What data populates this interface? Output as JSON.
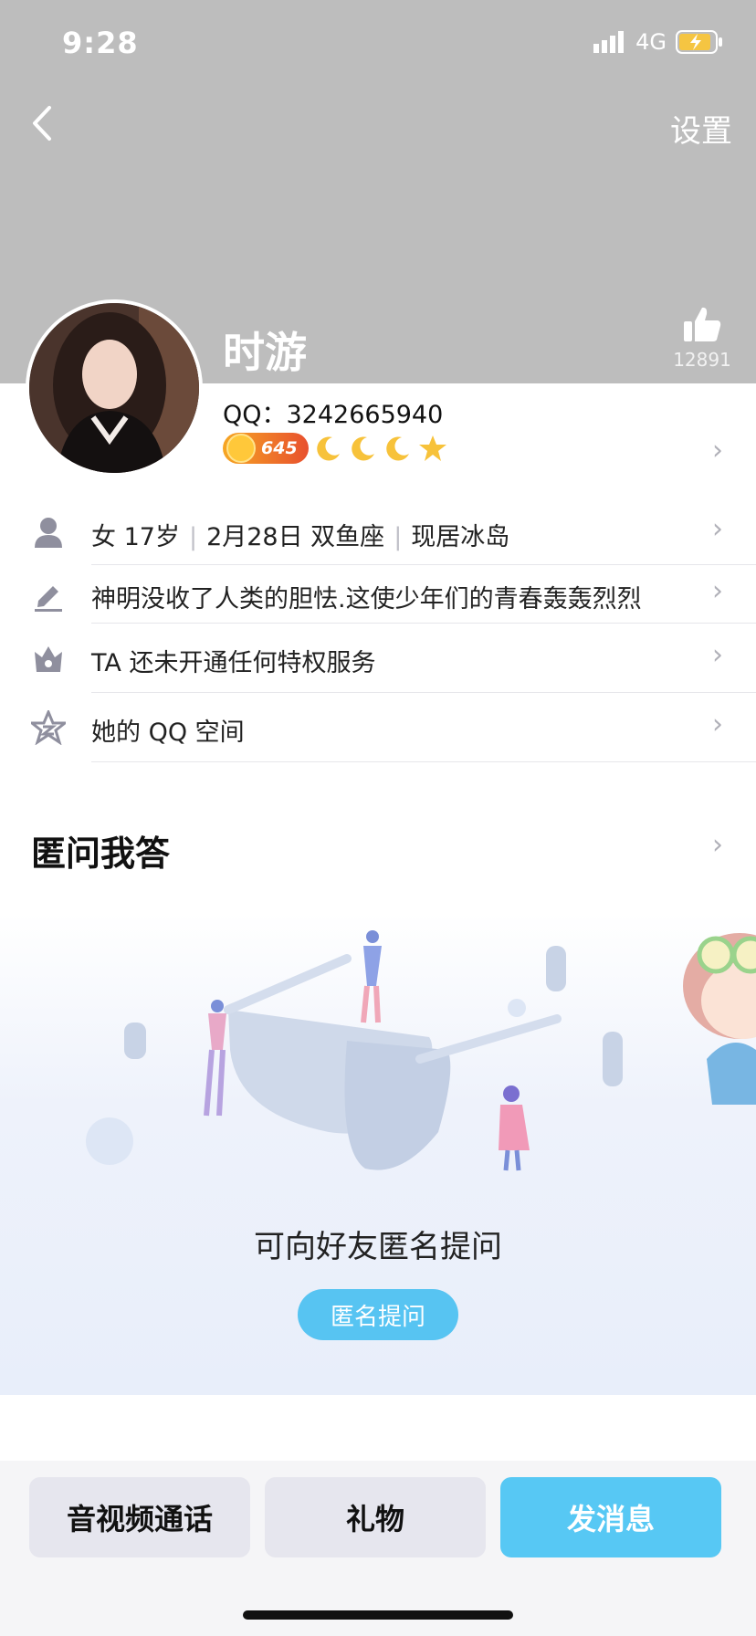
{
  "status_bar": {
    "time": "9:28",
    "network": "4G"
  },
  "nav": {
    "settings_label": "设置"
  },
  "profile": {
    "nickname": "时游",
    "likes": "12891",
    "qq_line": "QQ：3242665940",
    "coin_level": "645"
  },
  "info": {
    "gender": "女",
    "age": "17岁",
    "birthday": "2月28日 双鱼座",
    "location": "现居冰岛",
    "signature": "神明没收了人类的胆怯.这使少年们的青春轰轰烈烈",
    "privilege": "TA 还未开通任何特权服务",
    "qzone": "她的 QQ 空间"
  },
  "anonymous": {
    "title": "匿问我答",
    "prompt": "可向好友匿名提问",
    "button": "匿名提问"
  },
  "bottom": {
    "call": "音视频通话",
    "gift": "礼物",
    "message": "发消息"
  },
  "colors": {
    "accent": "#57c4f2",
    "header_bg": "#bdbdbd"
  }
}
